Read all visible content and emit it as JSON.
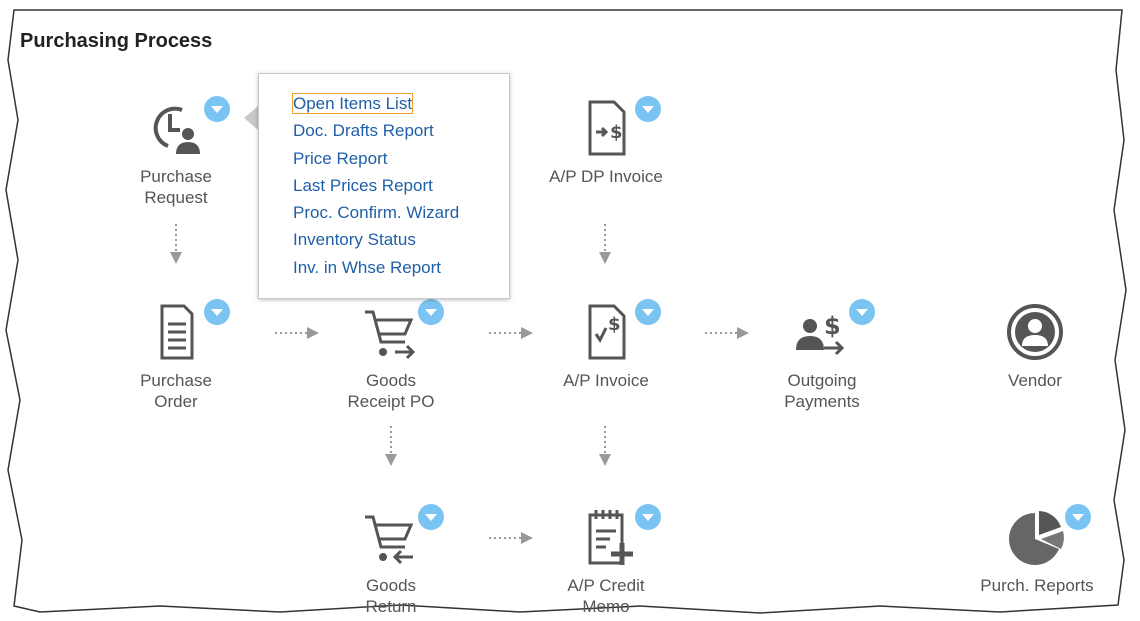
{
  "title": "Purchasing Process",
  "colors": {
    "badge": "#79c4f2",
    "icon": "#555555",
    "link": "#1f5fa8",
    "arrow": "#999999"
  },
  "nodes": {
    "purchase_request": {
      "label": "Purchase\nRequest",
      "icon": "clock-person-icon"
    },
    "ap_dp_invoice": {
      "label": "A/P DP Invoice",
      "icon": "document-dollar-icon"
    },
    "purchase_order": {
      "label": "Purchase\nOrder",
      "icon": "document-icon"
    },
    "goods_receipt_po": {
      "label": "Goods\nReceipt PO",
      "icon": "cart-arrow-right-icon"
    },
    "ap_invoice": {
      "label": "A/P Invoice",
      "icon": "invoice-check-dollar-icon"
    },
    "outgoing_payments": {
      "label": "Outgoing\nPayments",
      "icon": "people-dollar-icon"
    },
    "vendor": {
      "label": "Vendor",
      "icon": "person-circle-icon"
    },
    "goods_return": {
      "label": "Goods\nReturn",
      "icon": "cart-arrow-left-icon"
    },
    "ap_credit_memo": {
      "label": "A/P Credit\nMemo",
      "icon": "calendar-plus-icon"
    },
    "purch_reports": {
      "label": "Purch. Reports",
      "icon": "pie-chart-icon"
    }
  },
  "popup_menu": {
    "items": [
      "Open Items List",
      "Doc. Drafts Report",
      "Price Report",
      "Last Prices Report",
      "Proc. Confirm. Wizard",
      "Inventory Status",
      "Inv. in Whse Report"
    ],
    "focused_index": 0
  }
}
